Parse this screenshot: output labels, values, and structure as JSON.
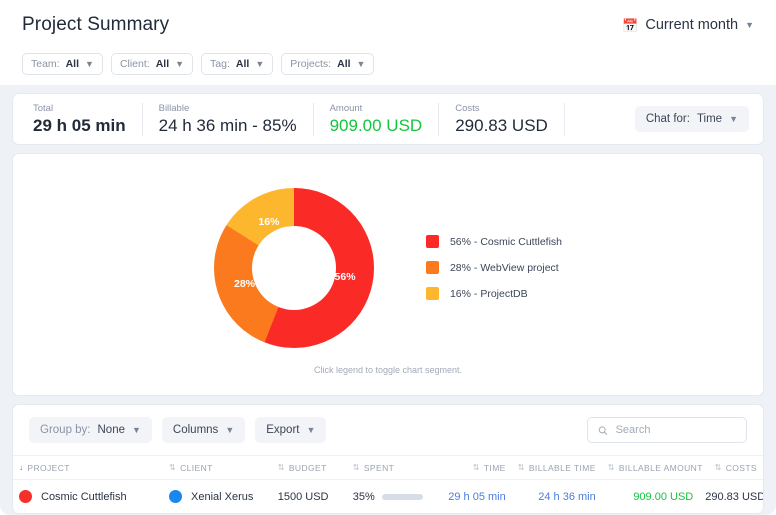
{
  "header": {
    "title": "Project Summary",
    "date_range": "Current month",
    "calendar_icon": "calendar-icon",
    "chevron_icon": "chevron-down-icon",
    "filters": [
      {
        "label": "Team:",
        "value": "All"
      },
      {
        "label": "Client:",
        "value": "All"
      },
      {
        "label": "Tag:",
        "value": "All"
      },
      {
        "label": "Projects:",
        "value": "All"
      }
    ]
  },
  "summary": {
    "stats": [
      {
        "label": "Total",
        "value": "29 h 05 min",
        "style": "bold"
      },
      {
        "label": "Billable",
        "value": "24 h 36 min - 85%",
        "style": "normal"
      },
      {
        "label": "Amount",
        "value": "909.00 USD",
        "style": "green"
      },
      {
        "label": "Costs",
        "value": "290.83 USD",
        "style": "normal"
      }
    ],
    "chart_for": {
      "label": "Chat for:",
      "value": "Time"
    }
  },
  "chart_data": {
    "type": "pie",
    "title": "",
    "legend_position": "right",
    "hint": "Click legend to toggle chart segment.",
    "categories": [
      "Cosmic Cuttlefish",
      "WebView project",
      "ProjectDB"
    ],
    "values": [
      56,
      28,
      16
    ],
    "unit": "%",
    "colors": [
      "#fa2b26",
      "#fb7a1e",
      "#fdb72e"
    ],
    "slice_labels": [
      "56%",
      "28%",
      "16%"
    ],
    "legend": [
      {
        "text": "56% - Cosmic Cuttlefish",
        "color": "#fa2b26"
      },
      {
        "text": "28% - WebView project",
        "color": "#fb7a1e"
      },
      {
        "text": "16% - ProjectDB",
        "color": "#fdb72e"
      }
    ]
  },
  "table_toolbar": {
    "group_by": {
      "label": "Group by:",
      "value": "None"
    },
    "columns_label": "Columns",
    "export_label": "Export",
    "search_placeholder": "Search",
    "search_value": "",
    "search_icon": "search-icon"
  },
  "table": {
    "columns": [
      {
        "key": "project",
        "label": "PROJECT",
        "sort": "desc",
        "align": "left"
      },
      {
        "key": "client",
        "label": "CLIENT",
        "sort": "none",
        "align": "left"
      },
      {
        "key": "budget",
        "label": "BUDGET",
        "sort": "none",
        "align": "left"
      },
      {
        "key": "spent",
        "label": "SPENT",
        "sort": "none",
        "align": "left"
      },
      {
        "key": "time",
        "label": "TIME",
        "sort": "none",
        "align": "right"
      },
      {
        "key": "billable_time",
        "label": "BILLABLE TIME",
        "sort": "none",
        "align": "right"
      },
      {
        "key": "billable_amount",
        "label": "BILLABLE AMOUNT",
        "sort": "none",
        "align": "right"
      },
      {
        "key": "costs",
        "label": "COSTS",
        "sort": "none",
        "align": "right"
      }
    ],
    "rows": [
      {
        "project": "Cosmic Cuttlefish",
        "project_color": "#f62f2a",
        "client": "Xenial Xerus",
        "client_color": "#1a86f0",
        "budget": "1500 USD",
        "spent_percent": "35%",
        "spent_fill": 35,
        "time": "29 h 05 min",
        "billable_time": "24 h 36 min",
        "billable_amount": "909.00 USD",
        "costs": "290.83 USD"
      }
    ]
  }
}
